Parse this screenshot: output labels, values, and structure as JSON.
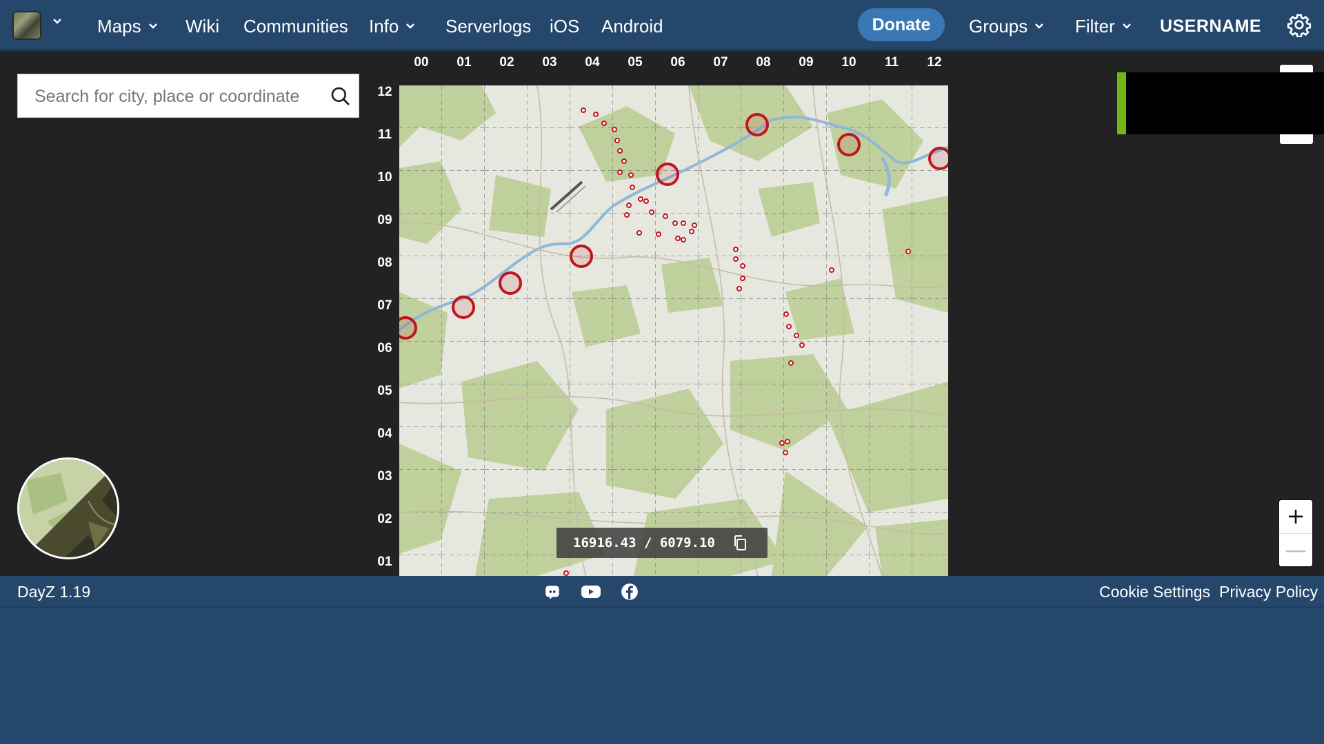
{
  "nav": {
    "maps": "Maps",
    "wiki": "Wiki",
    "communities": "Communities",
    "info": "Info",
    "serverlogs": "Serverlogs",
    "ios": "iOS",
    "android": "Android",
    "donate": "Donate",
    "groups": "Groups",
    "filter": "Filter",
    "username": "USERNAME"
  },
  "search": {
    "placeholder": "Search for city, place or coordinate"
  },
  "grid": {
    "columns": [
      "00",
      "01",
      "02",
      "03",
      "04",
      "05",
      "06",
      "07",
      "08",
      "09",
      "10",
      "11",
      "12"
    ],
    "rows": [
      "12",
      "11",
      "10",
      "09",
      "08",
      "07",
      "06",
      "05",
      "04",
      "03",
      "02",
      "01"
    ]
  },
  "coordinates": {
    "text": "16916.43 / 6079.10"
  },
  "zoom": {
    "in": "+",
    "out": "—"
  },
  "footer": {
    "version": "DayZ 1.19",
    "cookie_settings": "Cookie Settings",
    "privacy_policy": "Privacy Policy"
  },
  "colors": {
    "header": "#25476b",
    "map_bg": "#222222",
    "donate": "#3a78b5",
    "marker": "#c0141e",
    "ad_accent": "#6fb818"
  },
  "icons": [
    "app-logo",
    "chevron-down-icon",
    "gear-icon",
    "search-icon",
    "copy-icon",
    "discord-icon",
    "youtube-icon",
    "facebook-icon"
  ]
}
